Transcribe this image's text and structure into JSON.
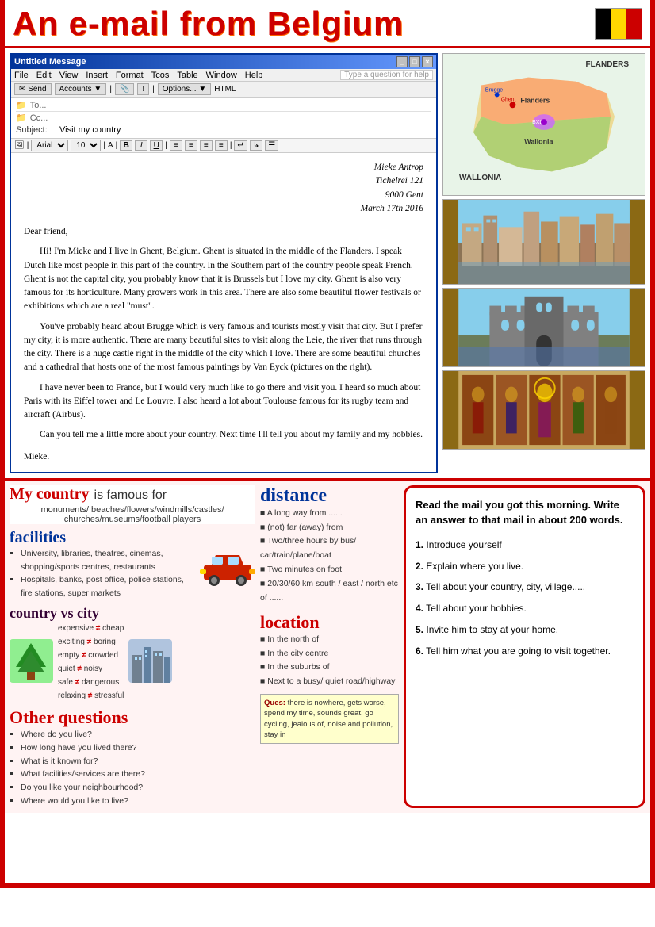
{
  "page": {
    "title": "An e-mail from Belgium",
    "header": {
      "title": "An e-mail from Belgium"
    },
    "flag": {
      "colors": [
        "#000000",
        "#FFD700",
        "#cc0000"
      ]
    },
    "map": {
      "label_flanders": "FLANDERS",
      "label_wallonia": "WALLONIA"
    },
    "email": {
      "window_title": "Untitled Message",
      "menu_items": [
        "File",
        "Edit",
        "View",
        "Insert",
        "Format",
        "Tcos",
        "Table",
        "Window",
        "Help"
      ],
      "help_placeholder": "Type a question for help",
      "toolbar": {
        "send": "Send",
        "accounts": "Accounts"
      },
      "fields": {
        "to_label": "To...",
        "cc_label": "Cc...",
        "subject_label": "Subject:",
        "subject_value": "Visit my country"
      },
      "format_bar": {
        "font": "Arial",
        "size": "10",
        "buttons": [
          "B",
          "I",
          "U"
        ]
      },
      "body": {
        "address": "Mieke Antrop\nTichelrei 121\n9000 Gent\nMarch 17th 2016",
        "greeting": "Dear friend,",
        "paragraph1": "Hi! I'm Mieke and I live in Ghent, Belgium. Ghent is situated in the middle of the Flanders. I speak Dutch like most people in this part of the country. In the Southern part of the country people speak French. Ghent is not the capital city, you probably know that it is Brussels but I love my city. Ghent is also very famous for its horticulture. Many growers work in this area. There are also some beautiful flower festivals or exhibitions which are a real \"must\".",
        "paragraph2": "You've probably heard about Brugge which is very famous and tourists mostly visit that city. But I prefer my city, it is more authentic. There are many beautiful sites to visit along the Leie, the river that runs through the city. There is a huge castle right in the middle of the city which I love. There are some beautiful churches and a cathedral that hosts one of the most famous paintings by Van Eyck (pictures on the right).",
        "paragraph3": "I have never been to France, but I would very much like to go there and visit you. I heard so much about Paris with its Eiffel tower and Le Louvre. I also heard a lot about Toulouse famous for its rugby team and aircraft (Airbus).",
        "paragraph4": "Can you tell me a little more about your country. Next time I'll tell you about my family and my hobbies.",
        "signature": "Mieke."
      }
    },
    "famous": {
      "title": "My country is famous for",
      "items": "monuments/ beaches/flowers/windmills/castles/ churches/museums/football players"
    },
    "facilities": {
      "title": "facilities",
      "items": [
        "University, libraries, theatres, cinemas, shopping/sports centres, restaurants",
        "Hospitals, banks, post office, police stations, fire stations, super markets"
      ]
    },
    "country_vs_city": {
      "title": "country vs city",
      "pairs": [
        {
          "left": "expensive",
          "sep": "≠",
          "right": "cheap"
        },
        {
          "left": "exciting",
          "sep": "≠",
          "right": "boring"
        },
        {
          "left": "empty",
          "sep": "≠",
          "right": "crowded"
        },
        {
          "left": "quiet",
          "sep": "≠",
          "right": "noisy"
        },
        {
          "left": "safe",
          "sep": "≠",
          "right": "dangerous"
        },
        {
          "left": "relaxing",
          "sep": "≠",
          "right": "stressful"
        }
      ]
    },
    "other_questions": {
      "title": "Other questions",
      "items": [
        "Where do you live?",
        "How long have you lived there?",
        "What is it known for?",
        "What facilities/services are there?",
        "Do you like your neighbourhood?",
        "Where would you like to live?"
      ]
    },
    "distance": {
      "title": "distance",
      "items": [
        "A long way from ......",
        "(not) far (away) from",
        "Two/three hours by bus/ car/train/plane/boat",
        "Two minutes on foot",
        "20/30/60 km south / east / north etc of ......"
      ]
    },
    "location": {
      "title": "location",
      "items": [
        "In the north of",
        "In the city centre",
        "In the suburbs of",
        "Next to a busy/ quiet road/highway"
      ]
    },
    "guess": {
      "label": "Ques:",
      "text": "there is nowhere, gets worse, spend my time, sounds great, go cycling, jealous of, noise and pollution, stay in"
    },
    "task": {
      "title": "Read the mail you got this morning. Write an answer to that mail in about 200 words.",
      "items": [
        {
          "num": "1.",
          "text": "Introduce yourself"
        },
        {
          "num": "2.",
          "text": "Explain where you live."
        },
        {
          "num": "3.",
          "text": "Tell about your country, city, village....."
        },
        {
          "num": "4.",
          "text": "Tell about your hobbies."
        },
        {
          "num": "5.",
          "text": "Invite him to stay at your home."
        },
        {
          "num": "6.",
          "text": "Tell him what you are going to visit together."
        }
      ]
    }
  }
}
